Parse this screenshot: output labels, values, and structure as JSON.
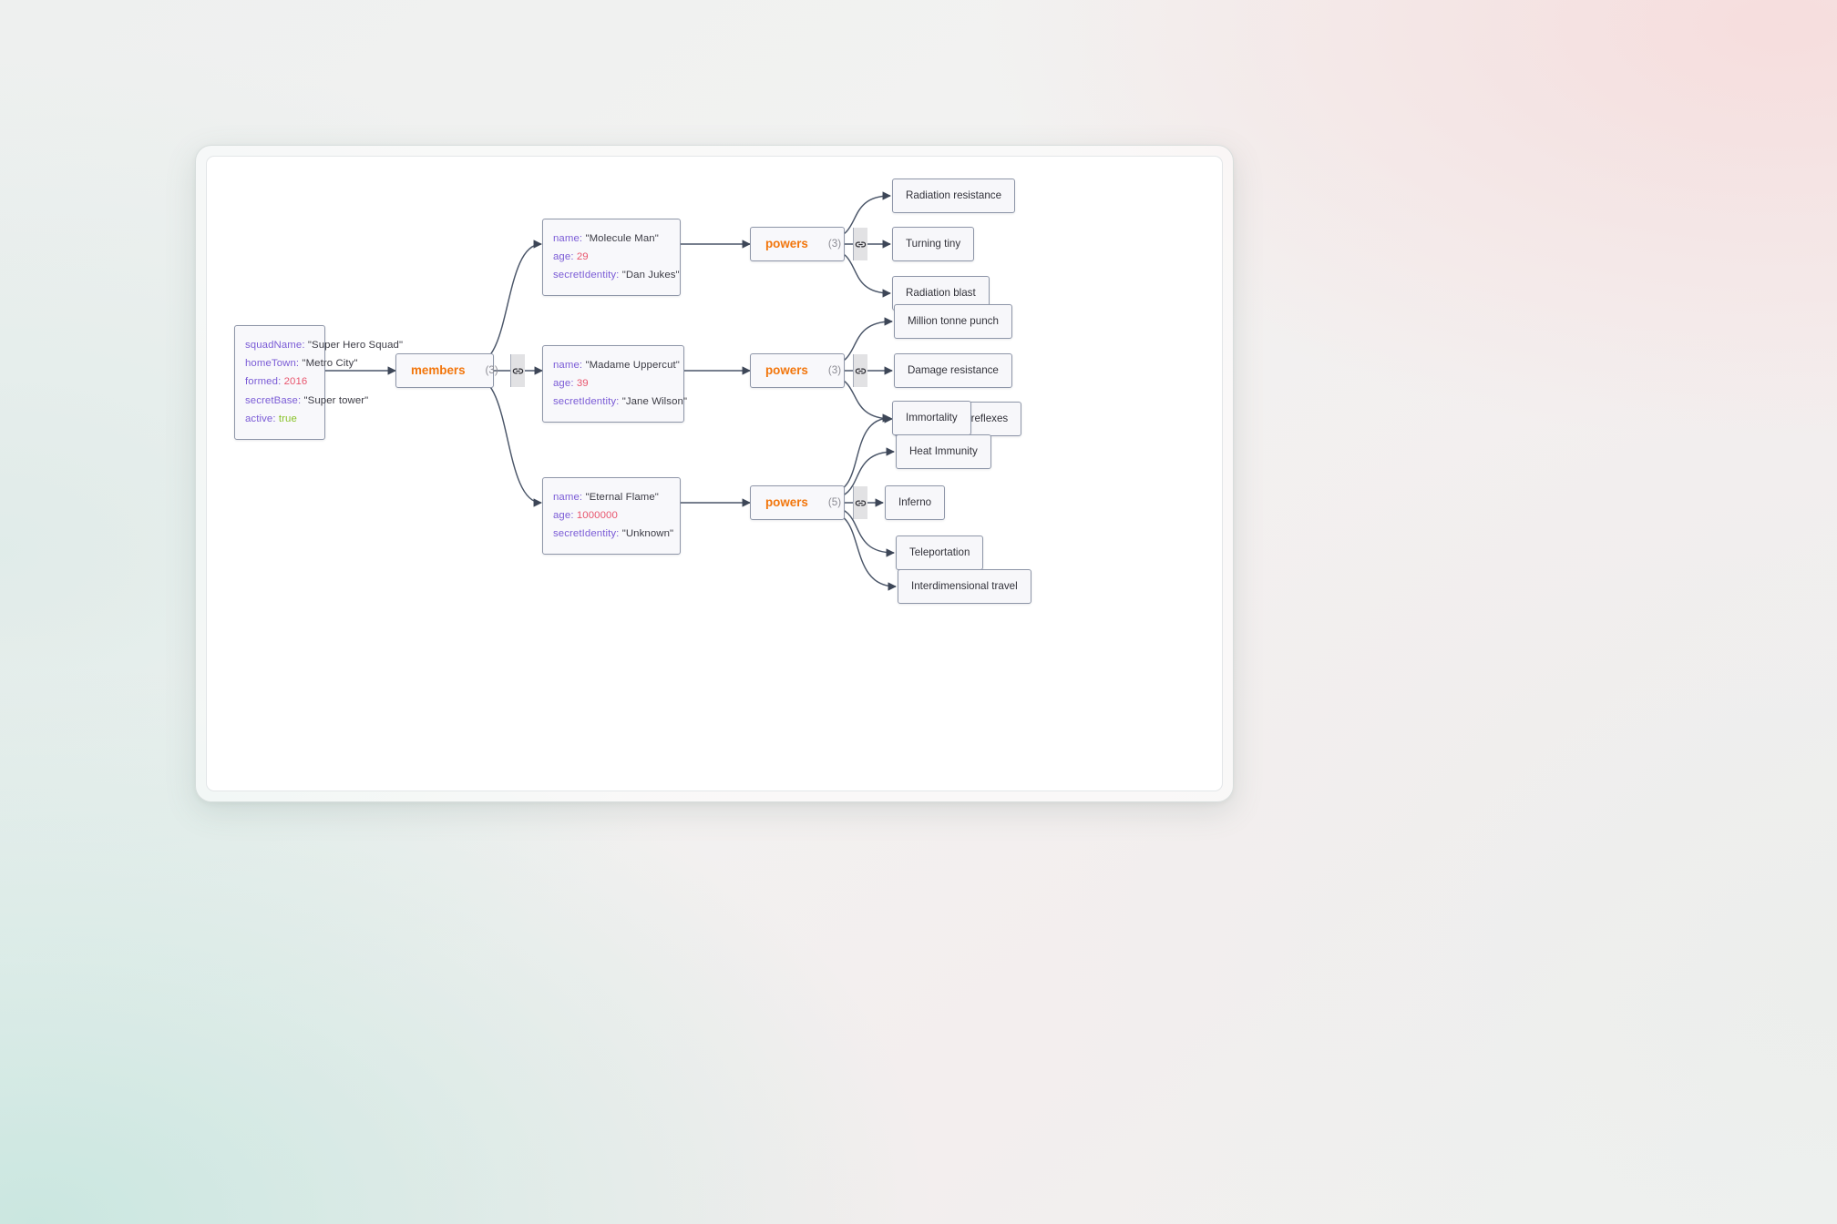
{
  "graph": {
    "root": {
      "name": "root-object-node",
      "rows": [
        {
          "key": "squadName",
          "value": "\"Super Hero Squad\"",
          "type": "string"
        },
        {
          "key": "homeTown",
          "value": "\"Metro City\"",
          "type": "string"
        },
        {
          "key": "formed",
          "value": "2016",
          "type": "number"
        },
        {
          "key": "secretBase",
          "value": "\"Super tower\"",
          "type": "string"
        },
        {
          "key": "active",
          "value": "true",
          "type": "boolean"
        }
      ]
    },
    "members_group": {
      "label": "members",
      "count": "(3)",
      "handle_icon": "link-icon"
    },
    "members": [
      {
        "rows": [
          {
            "key": "name",
            "value": "\"Molecule Man\"",
            "type": "string"
          },
          {
            "key": "age",
            "value": "29",
            "type": "number"
          },
          {
            "key": "secretIdentity",
            "value": "\"Dan Jukes\"",
            "type": "string"
          }
        ],
        "powers_group": {
          "label": "powers",
          "count": "(3)",
          "handle_icon": "link-icon"
        },
        "powers": [
          "Radiation resistance",
          "Turning tiny",
          "Radiation blast"
        ]
      },
      {
        "rows": [
          {
            "key": "name",
            "value": "\"Madame Uppercut\"",
            "type": "string"
          },
          {
            "key": "age",
            "value": "39",
            "type": "number"
          },
          {
            "key": "secretIdentity",
            "value": "\"Jane Wilson\"",
            "type": "string"
          }
        ],
        "powers_group": {
          "label": "powers",
          "count": "(3)",
          "handle_icon": "link-icon"
        },
        "powers": [
          "Million tonne punch",
          "Damage resistance",
          "Superhuman reflexes"
        ]
      },
      {
        "rows": [
          {
            "key": "name",
            "value": "\"Eternal Flame\"",
            "type": "string"
          },
          {
            "key": "age",
            "value": "1000000",
            "type": "number"
          },
          {
            "key": "secretIdentity",
            "value": "\"Unknown\"",
            "type": "string"
          }
        ],
        "powers_group": {
          "label": "powers",
          "count": "(5)",
          "handle_icon": "link-icon"
        },
        "powers": [
          "Immortality",
          "Heat Immunity",
          "Inferno",
          "Teleportation",
          "Interdimensional travel"
        ]
      }
    ]
  },
  "colors": {
    "key": "#7b5cd6",
    "string_value": "#3b3b44",
    "number_value": "#e8556d",
    "boolean_value": "#88c227",
    "group_label": "#f2760c",
    "count": "#8b8b93",
    "node_border": "#8e96a8",
    "edge": "#4a5568",
    "canvas": "#ffffff"
  }
}
